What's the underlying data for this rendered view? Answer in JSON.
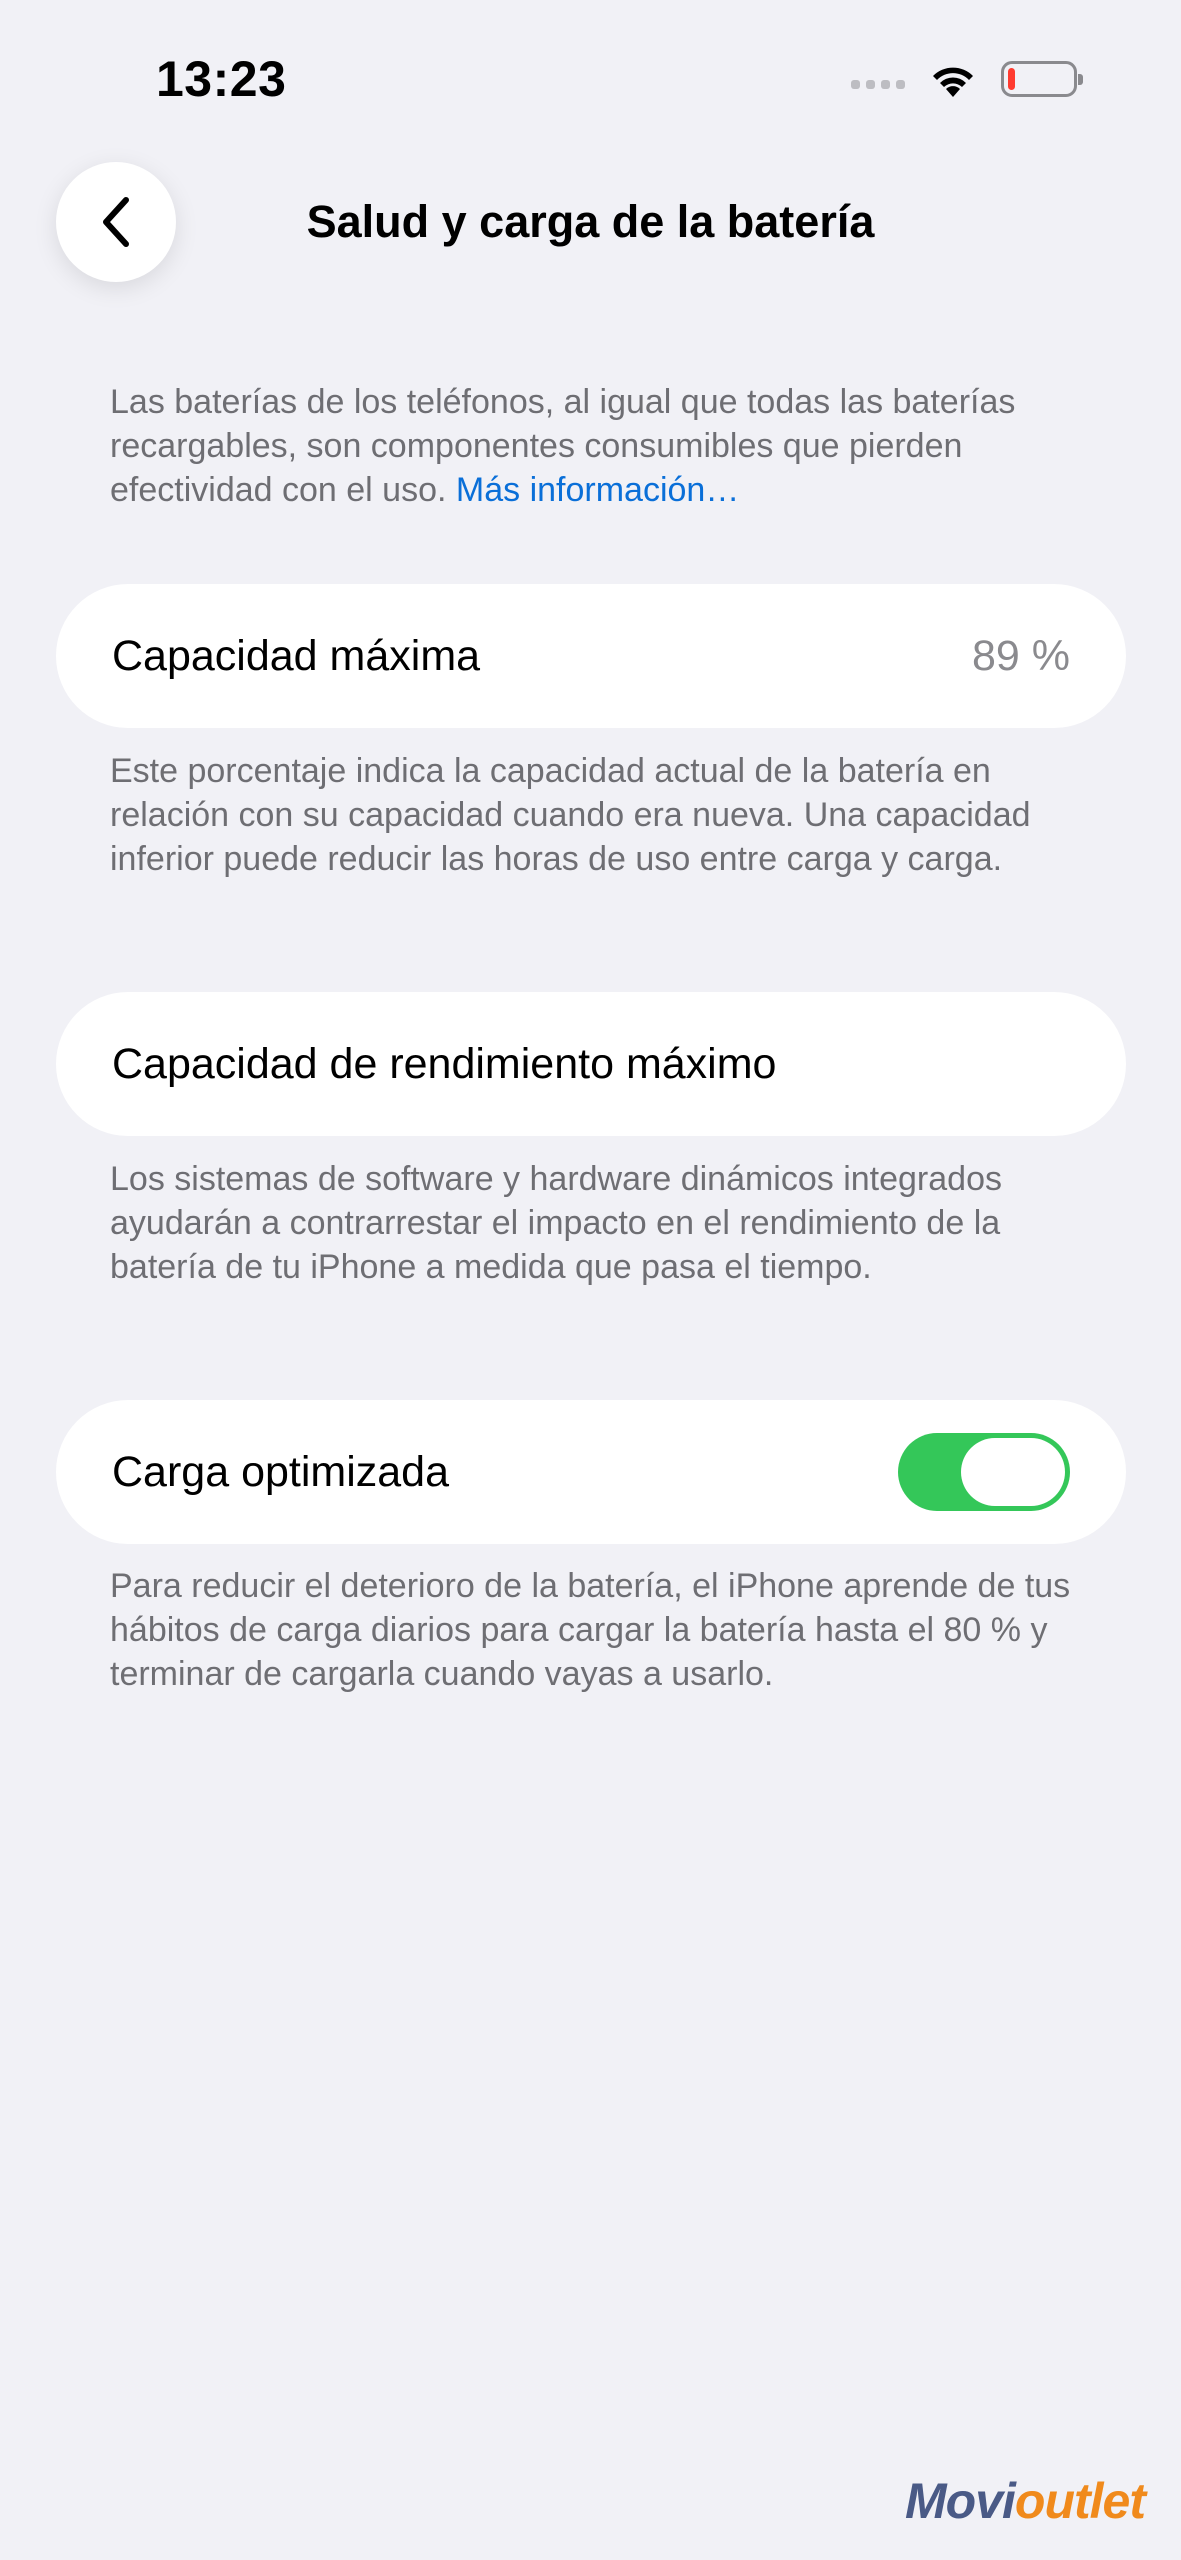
{
  "status_bar": {
    "time": "13:23",
    "icons": [
      "signal-dots-icon",
      "wifi-icon",
      "battery-low-icon"
    ],
    "battery_level": 0.12,
    "battery_color": "#ff3b30"
  },
  "nav": {
    "back_icon": "chevron-left-icon",
    "title": "Salud y carga de la batería"
  },
  "intro": {
    "text": "Las baterías de los teléfonos, al igual que todas las baterías recargables, son componentes consumibles que pierden efectividad con el uso.",
    "link": "Más información…",
    "link_color": "#0a6fd8"
  },
  "max_capacity": {
    "label": "Capacidad máxima",
    "value": "89 %",
    "note": "Este porcentaje indica la capacidad actual de la batería en relación con su capacidad cuando era nueva. Una capacidad inferior puede reducir las horas de uso entre carga y carga."
  },
  "peak_performance": {
    "label": "Capacidad de rendimiento máximo",
    "note": "Los sistemas de software y hardware dinámicos integrados ayudarán a contrarrestar el impacto en el rendimiento de la batería de tu iPhone a medida que pasa el tiempo."
  },
  "optimized_charging": {
    "label": "Carga optimizada",
    "enabled": true,
    "toggle_color": "#34c759",
    "note": "Para reducir el deterioro de la batería, el iPhone aprende de tus hábitos de carga diarios para cargar la batería hasta el 80 % y terminar de cargarla cuando vayas a usarlo."
  },
  "watermark": {
    "part1": "Movi",
    "part2": "outlet"
  }
}
